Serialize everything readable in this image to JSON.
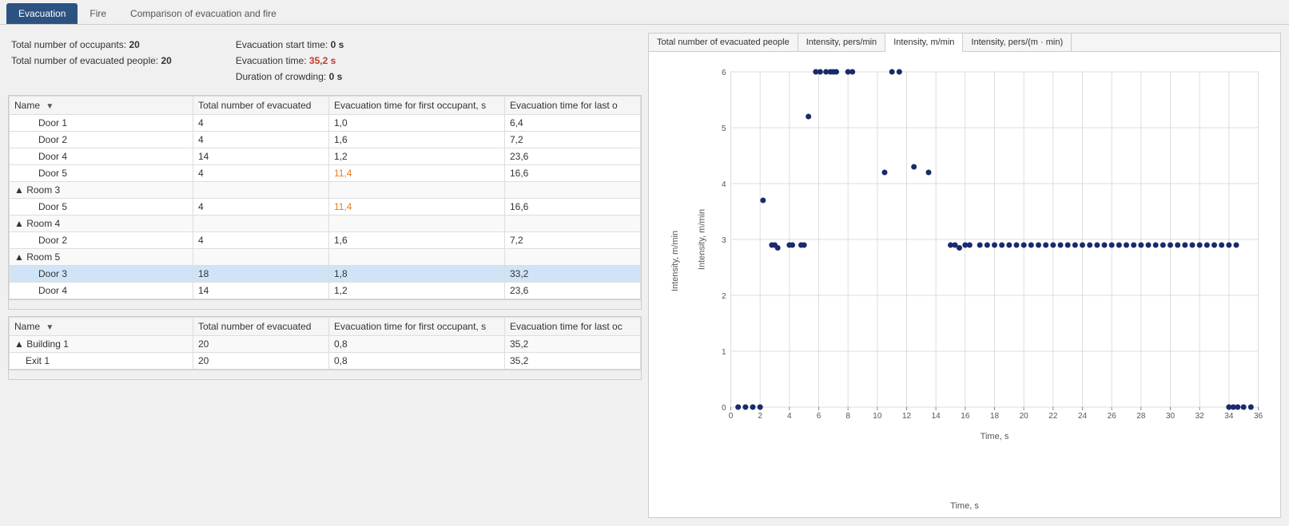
{
  "tabs": [
    {
      "label": "Evacuation",
      "active": true
    },
    {
      "label": "Fire",
      "active": false
    },
    {
      "label": "Comparison of evacuation and fire",
      "active": false
    }
  ],
  "stats": {
    "left": [
      {
        "label": "Total number of occupants:",
        "value": "20",
        "highlight": false
      },
      {
        "label": "Total number of evacuated people:",
        "value": "20",
        "highlight": false
      }
    ],
    "right": [
      {
        "label": "Evacuation start time:",
        "value": "0 s",
        "highlight": false
      },
      {
        "label": "Evacuation time:",
        "value": "35,2 s",
        "highlight": true
      },
      {
        "label": "Duration of crowding:",
        "value": "0 s",
        "highlight": false
      }
    ]
  },
  "table1": {
    "columns": [
      "Name",
      "Total number of evacuated",
      "Evacuation time for first occupant, s",
      "Evacuation time for last o"
    ],
    "rows": [
      {
        "name": "Door 1",
        "indent": 2,
        "evacuated": "4",
        "first": "1,0",
        "last": "6,4",
        "firstOrange": false,
        "selected": false,
        "isGroup": false
      },
      {
        "name": "Door 2",
        "indent": 2,
        "evacuated": "4",
        "first": "1,6",
        "last": "7,2",
        "firstOrange": false,
        "selected": false,
        "isGroup": false
      },
      {
        "name": "Door 4",
        "indent": 2,
        "evacuated": "14",
        "first": "1,2",
        "last": "23,6",
        "firstOrange": false,
        "selected": false,
        "isGroup": false
      },
      {
        "name": "Door 5",
        "indent": 2,
        "evacuated": "4",
        "first": "11,4",
        "last": "16,6",
        "firstOrange": true,
        "selected": false,
        "isGroup": false
      },
      {
        "name": "▲  Room 3",
        "indent": 0,
        "evacuated": "",
        "first": "",
        "last": "",
        "firstOrange": false,
        "selected": false,
        "isGroup": true
      },
      {
        "name": "Door 5",
        "indent": 2,
        "evacuated": "4",
        "first": "11,4",
        "last": "16,6",
        "firstOrange": true,
        "selected": false,
        "isGroup": false
      },
      {
        "name": "▲  Room 4",
        "indent": 0,
        "evacuated": "",
        "first": "",
        "last": "",
        "firstOrange": false,
        "selected": false,
        "isGroup": true
      },
      {
        "name": "Door 2",
        "indent": 2,
        "evacuated": "4",
        "first": "1,6",
        "last": "7,2",
        "firstOrange": false,
        "selected": false,
        "isGroup": false
      },
      {
        "name": "▲  Room 5",
        "indent": 0,
        "evacuated": "",
        "first": "",
        "last": "",
        "firstOrange": false,
        "selected": false,
        "isGroup": true
      },
      {
        "name": "Door 3",
        "indent": 2,
        "evacuated": "18",
        "first": "1,8",
        "last": "33,2",
        "firstOrange": false,
        "selected": true,
        "isGroup": false
      },
      {
        "name": "Door 4",
        "indent": 2,
        "evacuated": "14",
        "first": "1,2",
        "last": "23,6",
        "firstOrange": false,
        "selected": false,
        "isGroup": false
      }
    ]
  },
  "table2": {
    "columns": [
      "Name",
      "Total number of evacuated",
      "Evacuation time for first occupant, s",
      "Evacuation time for last oc"
    ],
    "rows": [
      {
        "name": "▲  Building 1",
        "indent": 0,
        "evacuated": "20",
        "first": "0,8",
        "last": "35,2",
        "isGroup": true
      },
      {
        "name": "Exit 1",
        "indent": 1,
        "evacuated": "20",
        "first": "0,8",
        "last": "35,2",
        "isGroup": false
      }
    ]
  },
  "chart": {
    "tabs": [
      "Total number of evacuated people",
      "Intensity, pers/min",
      "Intensity, m/min",
      "Intensity, pers/(m · min)"
    ],
    "active_tab": "Intensity, m/min",
    "y_label": "Intensity, m/min",
    "x_label": "Time, s",
    "y_max": 6,
    "x_max": 36,
    "y_ticks": [
      0,
      1,
      2,
      3,
      4,
      5,
      6
    ],
    "x_ticks": [
      0,
      2,
      4,
      6,
      8,
      10,
      12,
      14,
      16,
      18,
      20,
      22,
      24,
      26,
      28,
      30,
      32,
      34,
      36
    ],
    "data_points": [
      {
        "x": 0.5,
        "y": 0
      },
      {
        "x": 1.0,
        "y": 0
      },
      {
        "x": 1.5,
        "y": 0
      },
      {
        "x": 2.0,
        "y": 0
      },
      {
        "x": 2.2,
        "y": 3.7
      },
      {
        "x": 2.8,
        "y": 2.9
      },
      {
        "x": 3.0,
        "y": 2.9
      },
      {
        "x": 3.2,
        "y": 2.85
      },
      {
        "x": 4.0,
        "y": 2.9
      },
      {
        "x": 4.2,
        "y": 2.9
      },
      {
        "x": 4.8,
        "y": 2.9
      },
      {
        "x": 5.0,
        "y": 2.9
      },
      {
        "x": 5.3,
        "y": 5.2
      },
      {
        "x": 5.8,
        "y": 6.0
      },
      {
        "x": 6.1,
        "y": 6.0
      },
      {
        "x": 6.5,
        "y": 6.0
      },
      {
        "x": 6.8,
        "y": 6.0
      },
      {
        "x": 7.0,
        "y": 6.0
      },
      {
        "x": 7.2,
        "y": 6.0
      },
      {
        "x": 8.0,
        "y": 6.0
      },
      {
        "x": 8.3,
        "y": 6.0
      },
      {
        "x": 10.5,
        "y": 4.2
      },
      {
        "x": 11.0,
        "y": 6.0
      },
      {
        "x": 11.5,
        "y": 6.0
      },
      {
        "x": 12.5,
        "y": 4.3
      },
      {
        "x": 13.5,
        "y": 4.2
      },
      {
        "x": 15.0,
        "y": 2.9
      },
      {
        "x": 15.3,
        "y": 2.9
      },
      {
        "x": 15.6,
        "y": 2.85
      },
      {
        "x": 16.0,
        "y": 2.9
      },
      {
        "x": 16.3,
        "y": 2.9
      },
      {
        "x": 17.0,
        "y": 2.9
      },
      {
        "x": 17.5,
        "y": 2.9
      },
      {
        "x": 18.0,
        "y": 2.9
      },
      {
        "x": 18.5,
        "y": 2.9
      },
      {
        "x": 19.0,
        "y": 2.9
      },
      {
        "x": 19.5,
        "y": 2.9
      },
      {
        "x": 20.0,
        "y": 2.9
      },
      {
        "x": 20.5,
        "y": 2.9
      },
      {
        "x": 21.0,
        "y": 2.9
      },
      {
        "x": 21.5,
        "y": 2.9
      },
      {
        "x": 22.0,
        "y": 2.9
      },
      {
        "x": 22.5,
        "y": 2.9
      },
      {
        "x": 23.0,
        "y": 2.9
      },
      {
        "x": 23.5,
        "y": 2.9
      },
      {
        "x": 24.0,
        "y": 2.9
      },
      {
        "x": 24.5,
        "y": 2.9
      },
      {
        "x": 25.0,
        "y": 2.9
      },
      {
        "x": 25.5,
        "y": 2.9
      },
      {
        "x": 26.0,
        "y": 2.9
      },
      {
        "x": 26.5,
        "y": 2.9
      },
      {
        "x": 27.0,
        "y": 2.9
      },
      {
        "x": 27.5,
        "y": 2.9
      },
      {
        "x": 28.0,
        "y": 2.9
      },
      {
        "x": 28.5,
        "y": 2.9
      },
      {
        "x": 29.0,
        "y": 2.9
      },
      {
        "x": 29.5,
        "y": 2.9
      },
      {
        "x": 30.0,
        "y": 2.9
      },
      {
        "x": 30.5,
        "y": 2.9
      },
      {
        "x": 31.0,
        "y": 2.9
      },
      {
        "x": 31.5,
        "y": 2.9
      },
      {
        "x": 32.0,
        "y": 2.9
      },
      {
        "x": 32.5,
        "y": 2.9
      },
      {
        "x": 33.0,
        "y": 2.9
      },
      {
        "x": 33.5,
        "y": 2.9
      },
      {
        "x": 34.0,
        "y": 2.9
      },
      {
        "x": 34.5,
        "y": 2.9
      },
      {
        "x": 34.0,
        "y": 0
      },
      {
        "x": 34.3,
        "y": 0
      },
      {
        "x": 34.6,
        "y": 0
      },
      {
        "x": 35.0,
        "y": 0
      },
      {
        "x": 35.5,
        "y": 0
      }
    ]
  },
  "bottom_label": "Building"
}
